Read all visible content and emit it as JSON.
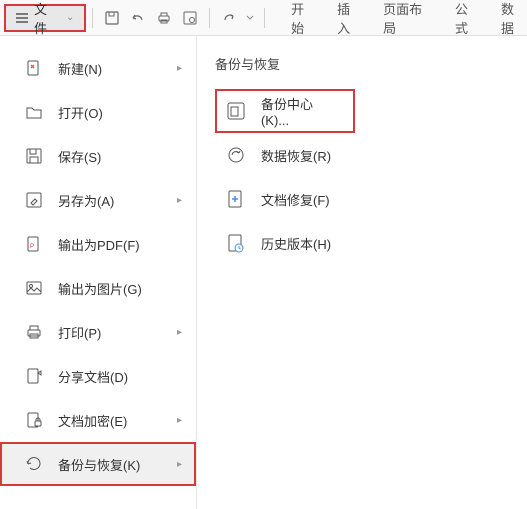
{
  "toolbar": {
    "file_label": "文件",
    "tabs": [
      "开始",
      "插入",
      "页面布局",
      "公式",
      "数据"
    ]
  },
  "left_menu": {
    "items": [
      {
        "label": "新建(N)",
        "icon": "new",
        "arrow": true
      },
      {
        "label": "打开(O)",
        "icon": "open",
        "arrow": false
      },
      {
        "label": "保存(S)",
        "icon": "save",
        "arrow": false
      },
      {
        "label": "另存为(A)",
        "icon": "saveas",
        "arrow": true
      },
      {
        "label": "输出为PDF(F)",
        "icon": "pdf",
        "arrow": false
      },
      {
        "label": "输出为图片(G)",
        "icon": "image",
        "arrow": false
      },
      {
        "label": "打印(P)",
        "icon": "print",
        "arrow": true
      },
      {
        "label": "分享文档(D)",
        "icon": "share",
        "arrow": false
      },
      {
        "label": "文档加密(E)",
        "icon": "encrypt",
        "arrow": true
      },
      {
        "label": "备份与恢复(K)",
        "icon": "backup",
        "arrow": true
      }
    ]
  },
  "right_panel": {
    "title": "备份与恢复",
    "items": [
      {
        "label": "备份中心(K)...",
        "icon": "backup-center"
      },
      {
        "label": "数据恢复(R)",
        "icon": "data-recover"
      },
      {
        "label": "文档修复(F)",
        "icon": "doc-repair"
      },
      {
        "label": "历史版本(H)",
        "icon": "history"
      }
    ]
  }
}
